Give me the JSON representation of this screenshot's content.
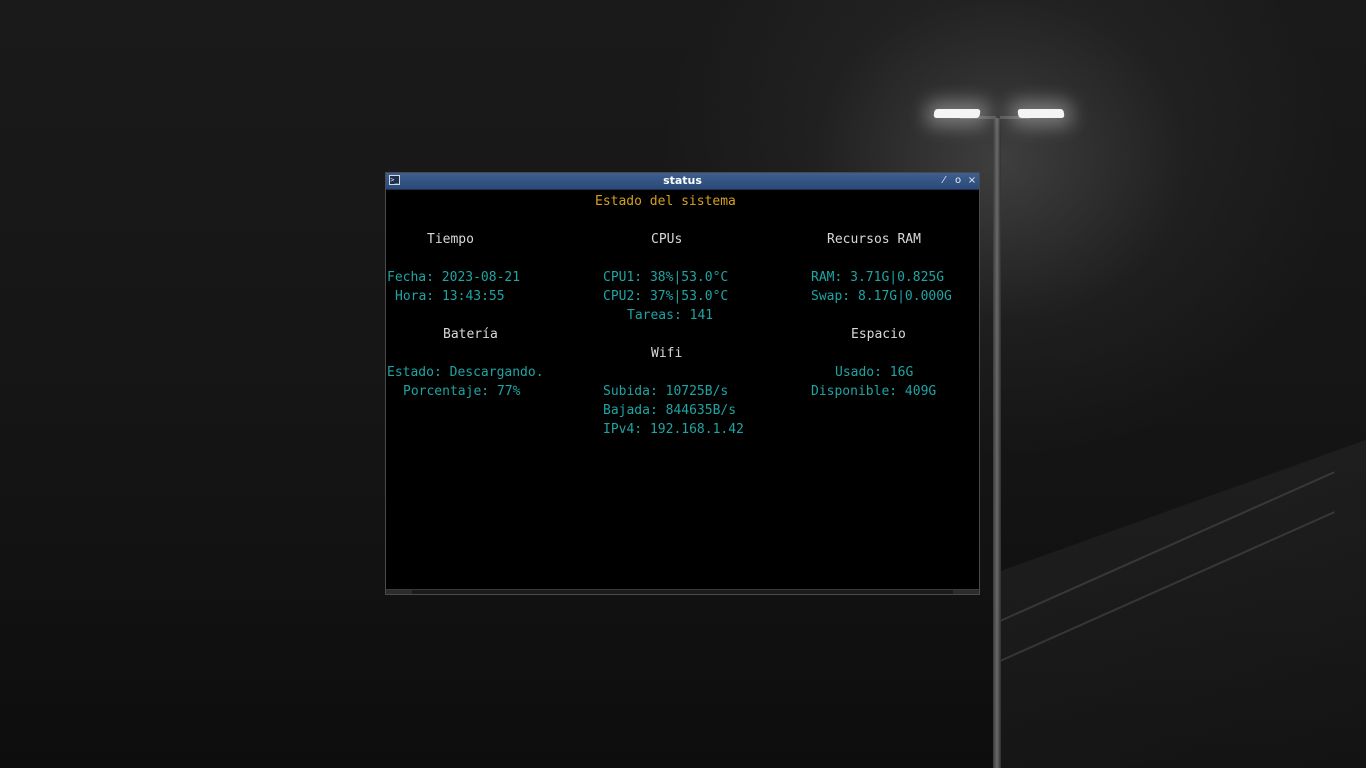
{
  "window": {
    "title": "status",
    "icon": "terminal-icon",
    "controls": [
      "edit-icon",
      "maximize-icon",
      "close-icon"
    ],
    "controls_glyphs": {
      "edit": "⁄",
      "max": "o",
      "close": "×"
    }
  },
  "terminal": {
    "heading": "Estado del sistema",
    "tiempo": {
      "title": "Tiempo",
      "fecha": "Fecha: 2023-08-21",
      "hora": "Hora: 13:43:55"
    },
    "cpus": {
      "title": "CPUs",
      "cpu1": "CPU1: 38%|53.0°C",
      "cpu2": "CPU2: 37%|53.0°C",
      "tareas": "Tareas: 141"
    },
    "ram": {
      "title": "Recursos RAM",
      "ram": "RAM: 3.71G|0.825G",
      "swap": "Swap: 8.17G|0.000G"
    },
    "bateria": {
      "title": "Batería",
      "estado": "Estado: Descargando.",
      "porcentaje": "Porcentaje: 77%"
    },
    "wifi": {
      "title": "Wifi",
      "subida": "Subida: 10725B/s",
      "bajada": "Bajada: 844635B/s",
      "ipv4": "IPv4: 192.168.1.42"
    },
    "espacio": {
      "title": "Espacio",
      "usado": "Usado: 16G",
      "disponible": "Disponible: 409G"
    }
  },
  "colors": {
    "heading": "#d4a01e",
    "value": "#1fa4a4",
    "section_title": "#d8d8d8",
    "titlebar": "#2f5080"
  }
}
